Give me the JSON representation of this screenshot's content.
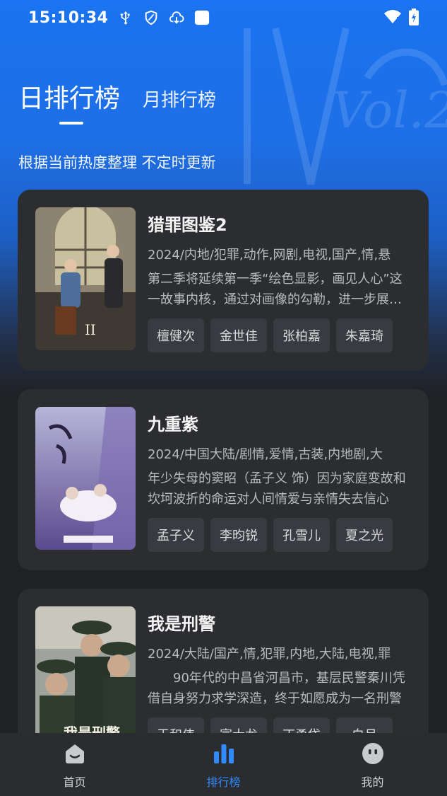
{
  "status_bar": {
    "time": "15:10:34",
    "left_icons": [
      "usb-icon",
      "shield-icon",
      "cloud-download-icon",
      "square-notification-icon"
    ],
    "right_icons": [
      "wifi-alert-icon",
      "battery-charging-icon"
    ]
  },
  "tabs": {
    "day": "日排行榜",
    "month": "月排行榜",
    "active": "day"
  },
  "subtitle": "根据当前热度整理 不定时更新",
  "items": [
    {
      "title": "猎罪图鉴2",
      "meta": "2024/内地/犯罪,动作,网剧,电视,国产,情,悬",
      "desc": "第二季将延续第一季“绘色显影，画见人心”这一故事内核，通过对画像的勾勒，进一步展现人性的复杂",
      "actors": [
        "檀健次",
        "金世佳",
        "张柏嘉",
        "朱嘉琦"
      ]
    },
    {
      "title": "九重紫",
      "meta": "2024/中国大陆/剧情,爱情,古装,内地剧,大",
      "desc": "年少失母的窦昭（孟子义 饰）因为家庭变故和坎坷波折的命运对人间情爱与亲情失去信心",
      "actors": [
        "孟子义",
        "李昀锐",
        "孔雪儿",
        "夏之光"
      ]
    },
    {
      "title": "我是刑警",
      "meta": "2024/大陆/国产,情,犯罪,内地,大陆,电视,罪",
      "desc": "　　90年代的中昌省河昌市，基层民警秦川凭借自身努力求学深造，终于如愿成为一名刑警",
      "actors": [
        "于和伟",
        "富大龙",
        "丁勇岱",
        "白月"
      ]
    }
  ],
  "nav": [
    {
      "label": "首页",
      "icon": "home-icon",
      "active": false
    },
    {
      "label": "排行榜",
      "icon": "bar-chart-icon",
      "active": true
    },
    {
      "label": "我的",
      "icon": "profile-face-icon",
      "active": false
    }
  ],
  "colors": {
    "accent": "#2f8bff",
    "hero_blue": "#1a73f0",
    "background": "#1f2124",
    "card": "#2b2d31"
  }
}
